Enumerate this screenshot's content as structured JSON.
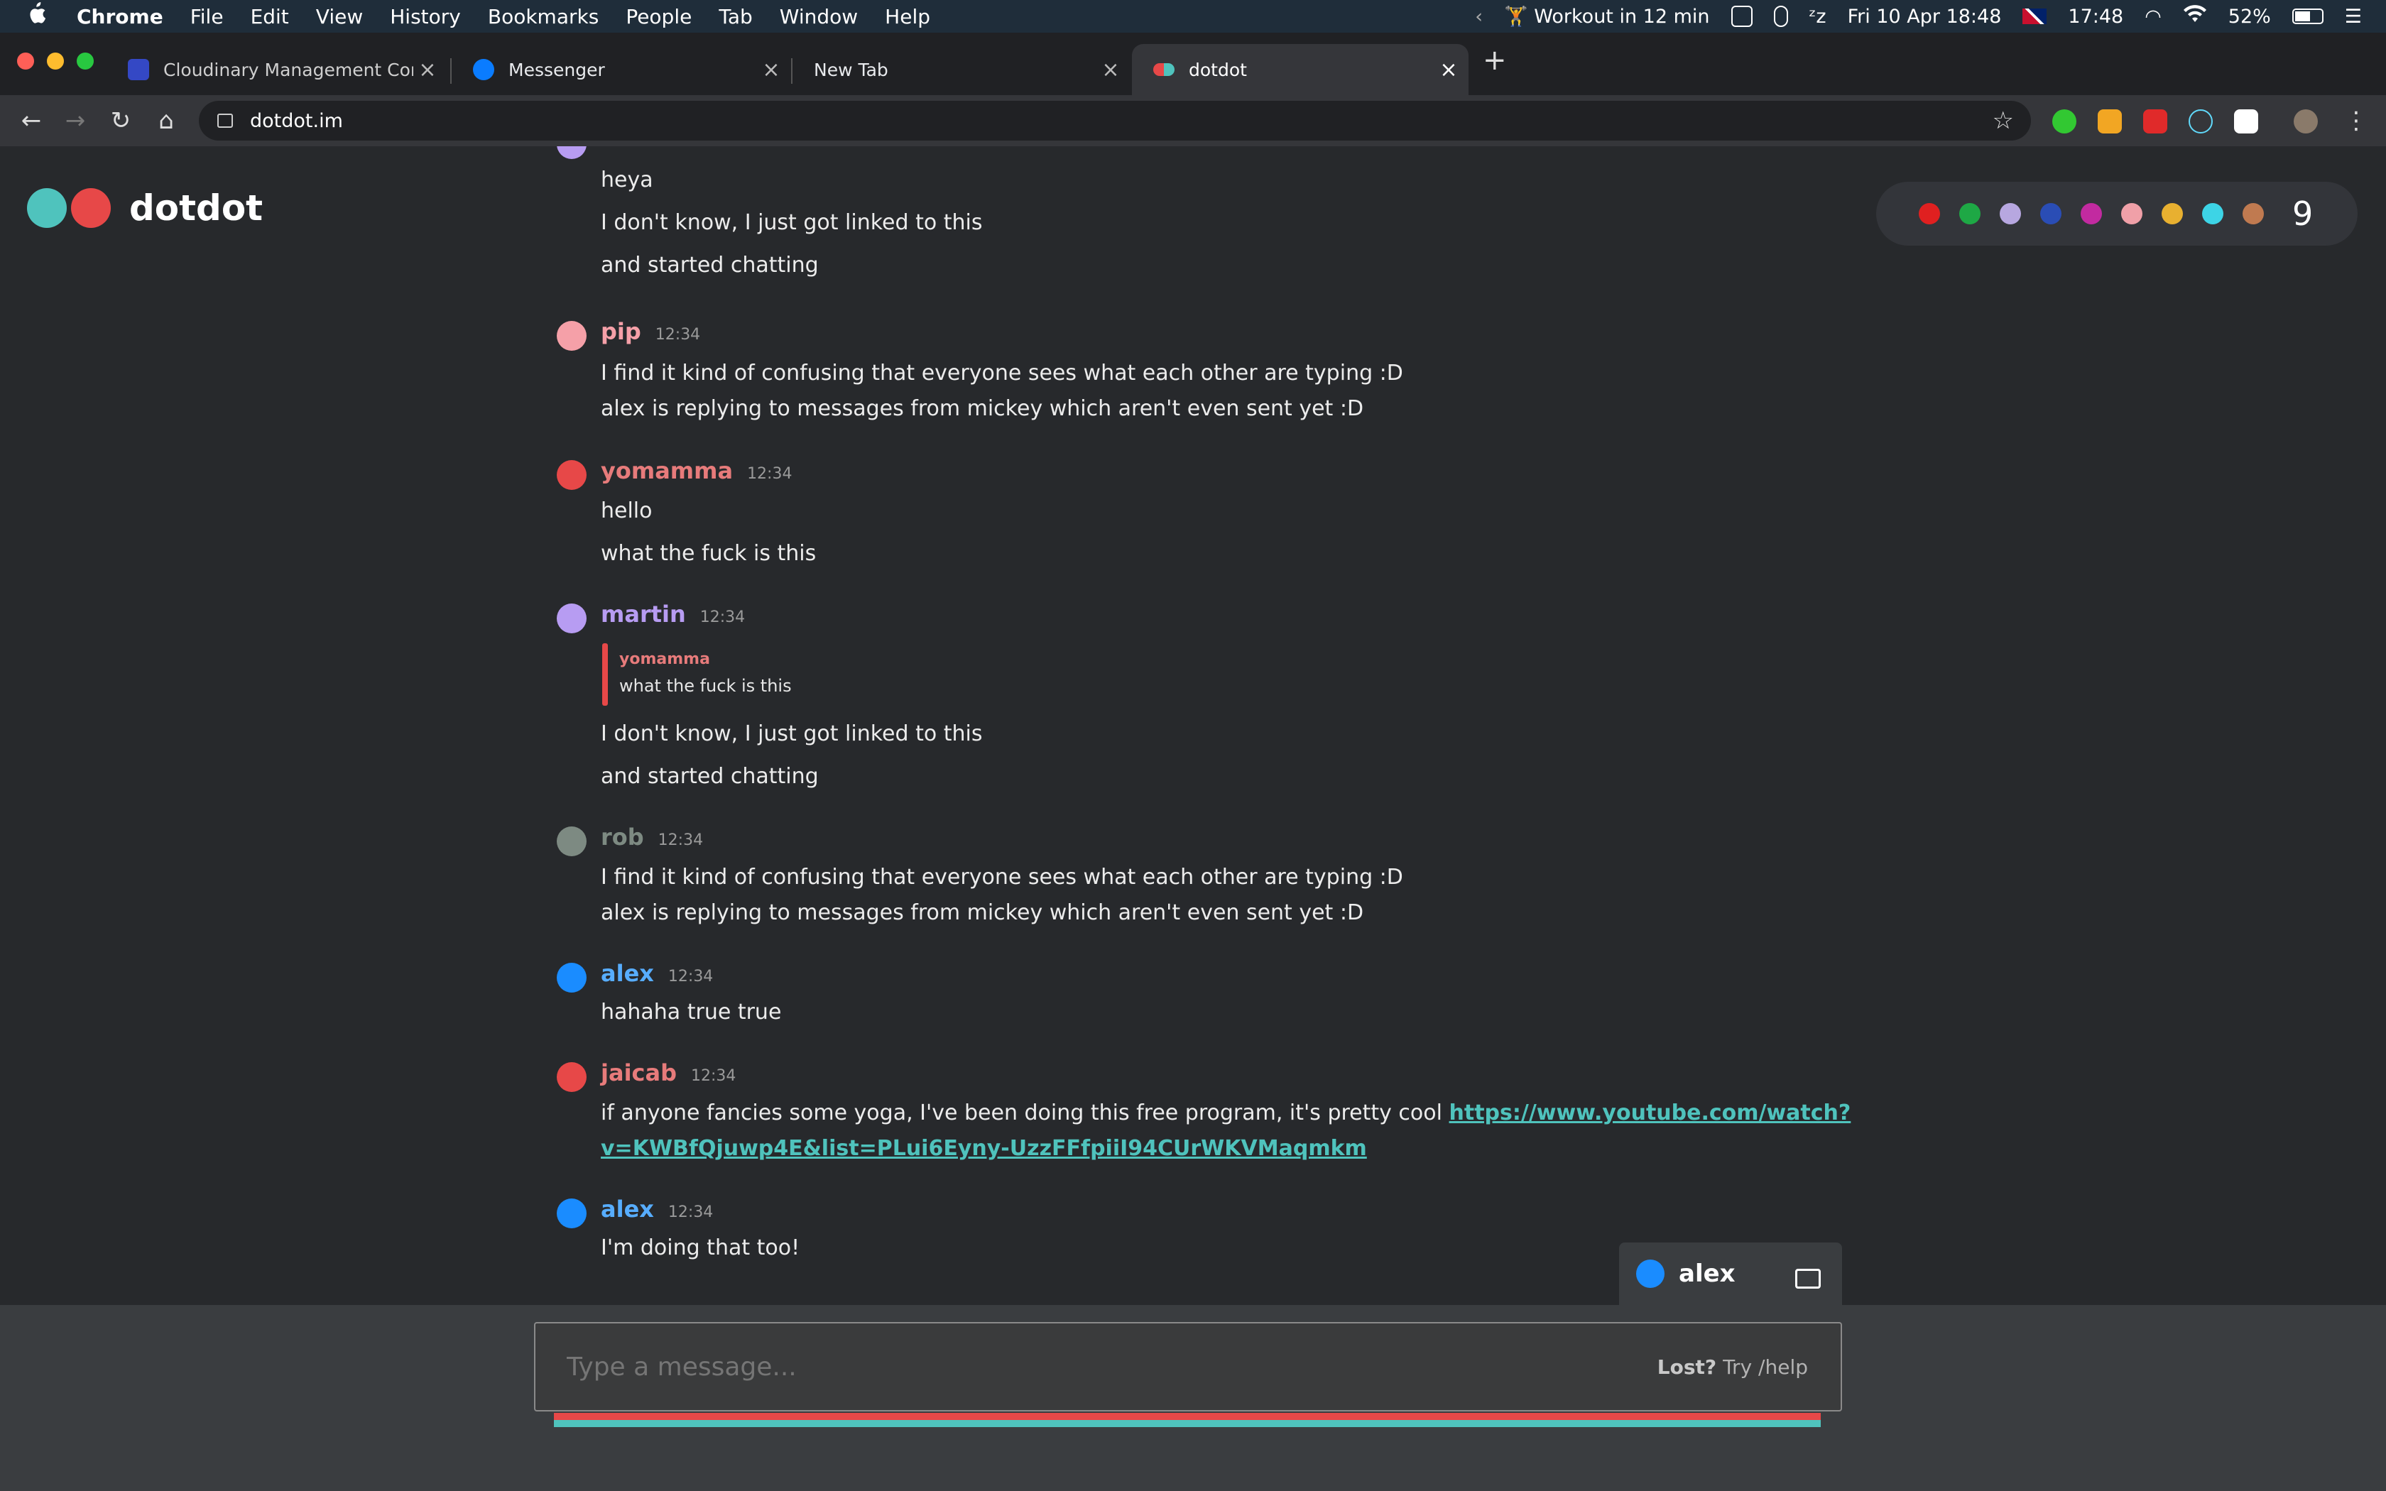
{
  "menubar": {
    "apple": "",
    "items": [
      "Chrome",
      "File",
      "Edit",
      "View",
      "History",
      "Bookmarks",
      "People",
      "Tab",
      "Window",
      "Help"
    ],
    "workout": "Workout in 12 min",
    "date": "Fri 10 Apr  18:48",
    "clock2": "17:48",
    "battery": "52%"
  },
  "tabs": [
    {
      "title": "Cloudinary Management Console",
      "favicon_color": "#3448c5",
      "active": false
    },
    {
      "title": "Messenger",
      "favicon_color": "#0a7cff",
      "active": false
    },
    {
      "title": "New Tab",
      "favicon_color": "",
      "active": false
    },
    {
      "title": "dotdot",
      "favicon_color": "#e74848",
      "active": true
    }
  ],
  "toolbar": {
    "url": "dotdot.im"
  },
  "app": {
    "logo_text": "dotdot",
    "logo_colors": [
      "#4fc3bd",
      "#e74848"
    ],
    "presence_colors": [
      "#e02020",
      "#1ea845",
      "#b7a7e0",
      "#2a4db5",
      "#c22aa0",
      "#f0a0a8",
      "#e8b030",
      "#3dd4e6",
      "#c07a50"
    ],
    "presence_count": "9"
  },
  "messages": [
    {
      "user": "",
      "time": "",
      "color": "#b79cf2",
      "lines": [
        "heya",
        "I don't know, I just got linked to this",
        "and started chatting"
      ]
    },
    {
      "user": "pip",
      "time": "12:34",
      "color": "#f5a0a8",
      "lines": [
        "I find it kind of confusing that everyone sees what each other are typing :D",
        "alex is replying to messages from mickey which aren't even sent yet :D"
      ]
    },
    {
      "user": "yomamma",
      "time": "12:34",
      "color": "#e74848",
      "lines": [
        "hello",
        "what the fuck is this"
      ]
    },
    {
      "user": "martin",
      "time": "12:34",
      "color": "#b79cf2",
      "quote": {
        "user": "yomamma",
        "text": "what the fuck is this"
      },
      "lines": [
        "I don't know, I just got linked to this",
        "and started chatting"
      ]
    },
    {
      "user": "rob",
      "time": "12:34",
      "color": "#7d8a82",
      "lines": [
        "I find it kind of confusing that everyone sees what each other are typing :D",
        "alex is replying to messages from mickey which aren't even sent yet :D"
      ]
    },
    {
      "user": "alex",
      "time": "12:34",
      "color": "#1a8cff",
      "lines": [
        "hahaha true true"
      ]
    },
    {
      "user": "jaicab",
      "time": "12:34",
      "color": "#e74848",
      "text_before": "if anyone fancies some yoga, I've been doing this free program, it's pretty cool ",
      "link_line1": "https://www.youtube.com/watch?",
      "link_line2": "v=KWBfQjuwp4E&list=PLui6Eyny-UzzFFfpiiI94CUrWKVMaqmkm"
    },
    {
      "user": "alex",
      "time": "12:34",
      "color": "#1a8cff",
      "lines": [
        "I'm doing that too!"
      ]
    }
  ],
  "current_user": {
    "name": "alex",
    "color": "#1a8cff"
  },
  "composer": {
    "placeholder": "Type a message...",
    "help_bold": "Lost?",
    "help_rest": "Try /help"
  }
}
